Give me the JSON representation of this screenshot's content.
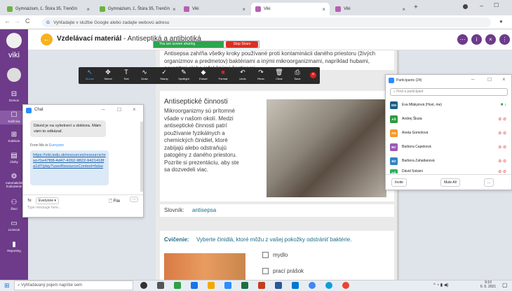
{
  "browser": {
    "tabs": [
      {
        "title": "Gymnázium, Ľ. Štúra 35, Trenčín"
      },
      {
        "title": "Gymnázium, Ľ. Štúra 35, Trenčín"
      },
      {
        "title": "Viki"
      },
      {
        "title": "Viki"
      },
      {
        "title": "Viki"
      }
    ],
    "address_placeholder": "Vyhľadajte v službe Google alebo zadajte webovú adresu"
  },
  "app": {
    "logo": "viki",
    "sidebar": [
      {
        "label": "Domov"
      },
      {
        "label": "Knižnica"
      },
      {
        "label": "Kolekcie"
      },
      {
        "label": "Úlohy"
      },
      {
        "label": "Automatické hodnotenie"
      },
      {
        "label": "Žiaci"
      },
      {
        "label": "Licencie"
      },
      {
        "label": "Reporting"
      }
    ],
    "title_prefix": "Vzdelávací materiál",
    "title_suffix": "Antiseptiká a antibiotiká"
  },
  "share": {
    "text": "You are screen sharing",
    "stop": "Stop Share"
  },
  "annotate": {
    "tools": [
      "Mouse",
      "Select",
      "Text",
      "Draw",
      "Stamp",
      "Spotlight",
      "Eraser",
      "Format",
      "Undo",
      "Redo",
      "Clear",
      "Save"
    ]
  },
  "content": {
    "intro": "Antisepsa zahŕňa všetky kroky používané proti kontaminácii daného priestoru (živých organizmov a predmetov) baktériami a inými mikroorganizmami, napríklad hubami, parazitmi alebo infekčnými časticami",
    "section_title": "Antiseptické činnosti",
    "section_text": "Mikroorganizmy sú prítomné všade v našom okolí. Medzi antiseptické činnosti patrí používanie fyzikálnych a chemických činidiel, ktoré zabíjajú alebo odstraňujú patogény z daného priestoru. Pozrite si prezentáciu, aby ste sa dozvedeli viac.",
    "glossary_label": "Slovník:",
    "glossary_term": "antisepsa",
    "exercise_label": "Cvičenie:",
    "exercise_text": "Vyberte činidlá, ktoré môžu z vašej pokožky odstrániť baktérie.",
    "options": [
      "mydlo",
      "prací prášok"
    ]
  },
  "chat": {
    "title": "Chat",
    "message": "Dávid je na vyšetrení u doktora. Mám vám to odkázať.",
    "from": "From Me to",
    "to": "Everyone",
    "link": "https://viki.iedu.sk/resources/resource/reso-f1e47f08-4d47-4262-9822-9421418fa1d7/play?userResourceContext=false",
    "to_label": "To:",
    "to_value": "Everyone",
    "file": "File",
    "placeholder": "Type message here..."
  },
  "participants": {
    "title": "Participants (24)",
    "search": "Find a participant",
    "list": [
      {
        "initials": "EM",
        "name": "Eva Mlákyiová (Host, me)",
        "color": "#1a5e8a"
      },
      {
        "initials": "AŠ",
        "name": "Andrej Škuta",
        "color": "#2e9a3e"
      },
      {
        "initials": "AG",
        "name": "Aneta Gomolová",
        "color": "#f29a2e"
      },
      {
        "initials": "BC",
        "name": "Barbora Capeková",
        "color": "#9b59b6"
      },
      {
        "initials": "BZ",
        "name": "Barbora Zahatlanová",
        "color": "#2e86c1"
      },
      {
        "initials": "DŠ",
        "name": "Dávid Šobáni",
        "color": "#27ae60"
      }
    ],
    "invite": "Invite",
    "mute": "Mute All",
    "more": "..."
  },
  "taskbar": {
    "search": "Vyhľadávaný pojem napíšte sem",
    "time": "9:10",
    "date": "6. 5. 2021"
  }
}
